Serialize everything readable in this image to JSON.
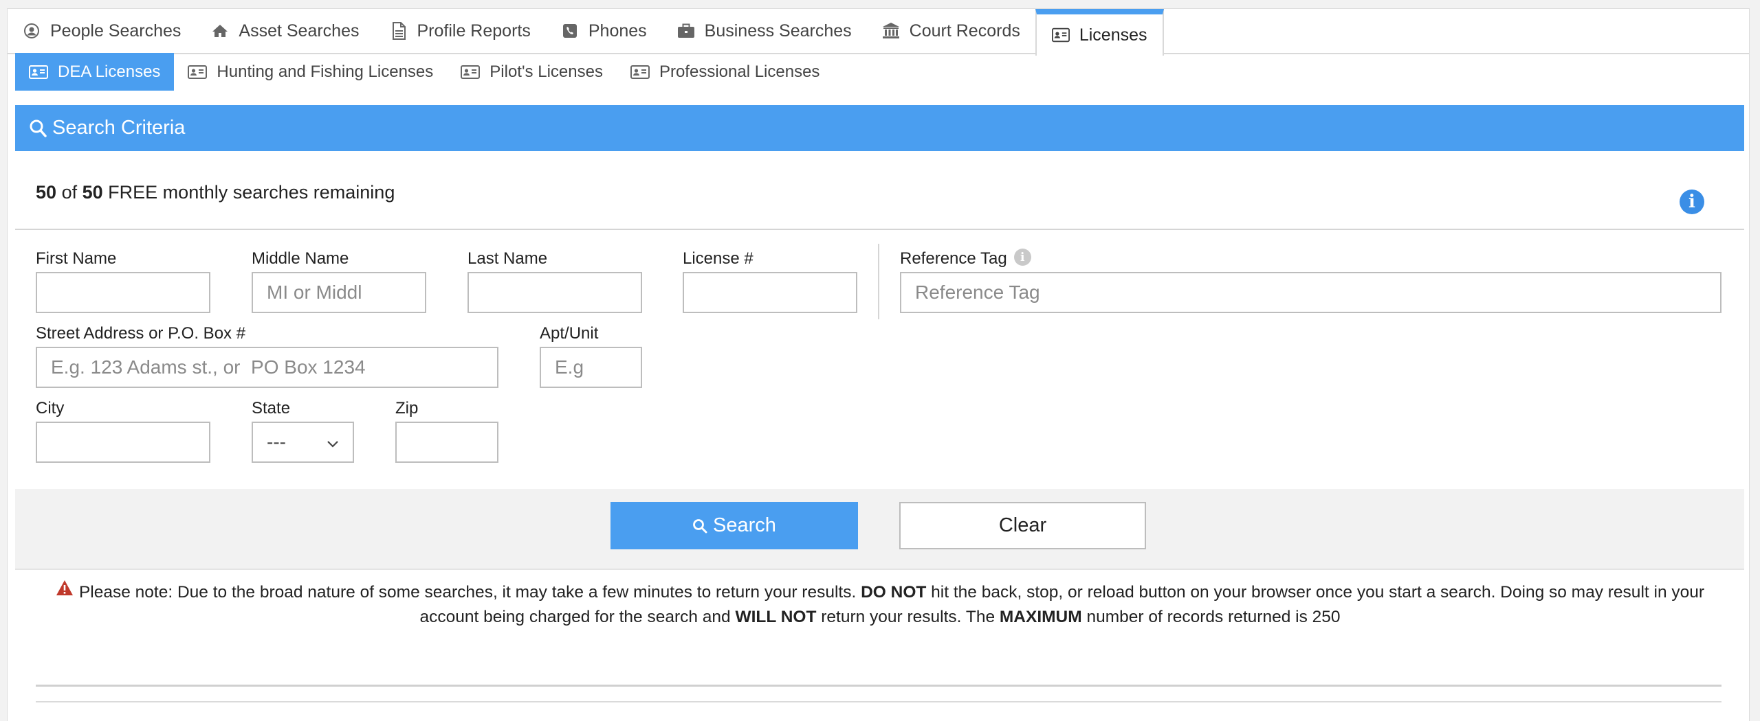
{
  "top_tabs": [
    {
      "label": "People Searches",
      "icon": "user-circle-icon"
    },
    {
      "label": "Asset Searches",
      "icon": "home-icon"
    },
    {
      "label": "Profile Reports",
      "icon": "document-icon"
    },
    {
      "label": "Phones",
      "icon": "phone-icon"
    },
    {
      "label": "Business Searches",
      "icon": "briefcase-icon"
    },
    {
      "label": "Court Records",
      "icon": "courthouse-icon"
    },
    {
      "label": "Licenses",
      "icon": "id-card-icon",
      "active": true
    }
  ],
  "sub_tabs": [
    {
      "label": "DEA Licenses",
      "active": true
    },
    {
      "label": "Hunting and Fishing Licenses"
    },
    {
      "label": "Pilot's Licenses"
    },
    {
      "label": "Professional Licenses"
    }
  ],
  "criteria": {
    "title": "Search Criteria"
  },
  "remaining": {
    "used": "50",
    "of": "of",
    "total": "50",
    "text": "FREE monthly searches remaining"
  },
  "fields": {
    "first_name": {
      "label": "First Name",
      "value": "",
      "placeholder": ""
    },
    "middle_name": {
      "label": "Middle Name",
      "value": "",
      "placeholder": "MI or Middl"
    },
    "last_name": {
      "label": "Last Name",
      "value": "",
      "placeholder": ""
    },
    "license": {
      "label": "License #",
      "value": "",
      "placeholder": ""
    },
    "reference_tag": {
      "label": "Reference Tag",
      "value": "",
      "placeholder": "Reference Tag"
    },
    "street": {
      "label": "Street Address or P.O. Box #",
      "value": "",
      "placeholder": "E.g. 123 Adams st., or  PO Box 1234"
    },
    "apt": {
      "label": "Apt/Unit",
      "value": "",
      "placeholder": "E.g"
    },
    "city": {
      "label": "City",
      "value": "",
      "placeholder": ""
    },
    "state": {
      "label": "State",
      "selected": "---"
    },
    "zip": {
      "label": "Zip",
      "value": "",
      "placeholder": ""
    }
  },
  "actions": {
    "search_label": "Search",
    "clear_label": "Clear"
  },
  "note": {
    "part1": "Please note: Due to the broad nature of some searches, it may take a few minutes to return your results.",
    "bold1": "DO NOT",
    "part2": "hit the back, stop, or reload button on your browser once you start a search. Doing so may result in your account being charged for the search and",
    "bold2": "WILL NOT",
    "part3": "return your results. The",
    "bold3": "MAXIMUM",
    "part4": "number of records returned is 250"
  },
  "colors": {
    "accent": "#4a9ef0",
    "warning": "#c0392b"
  }
}
